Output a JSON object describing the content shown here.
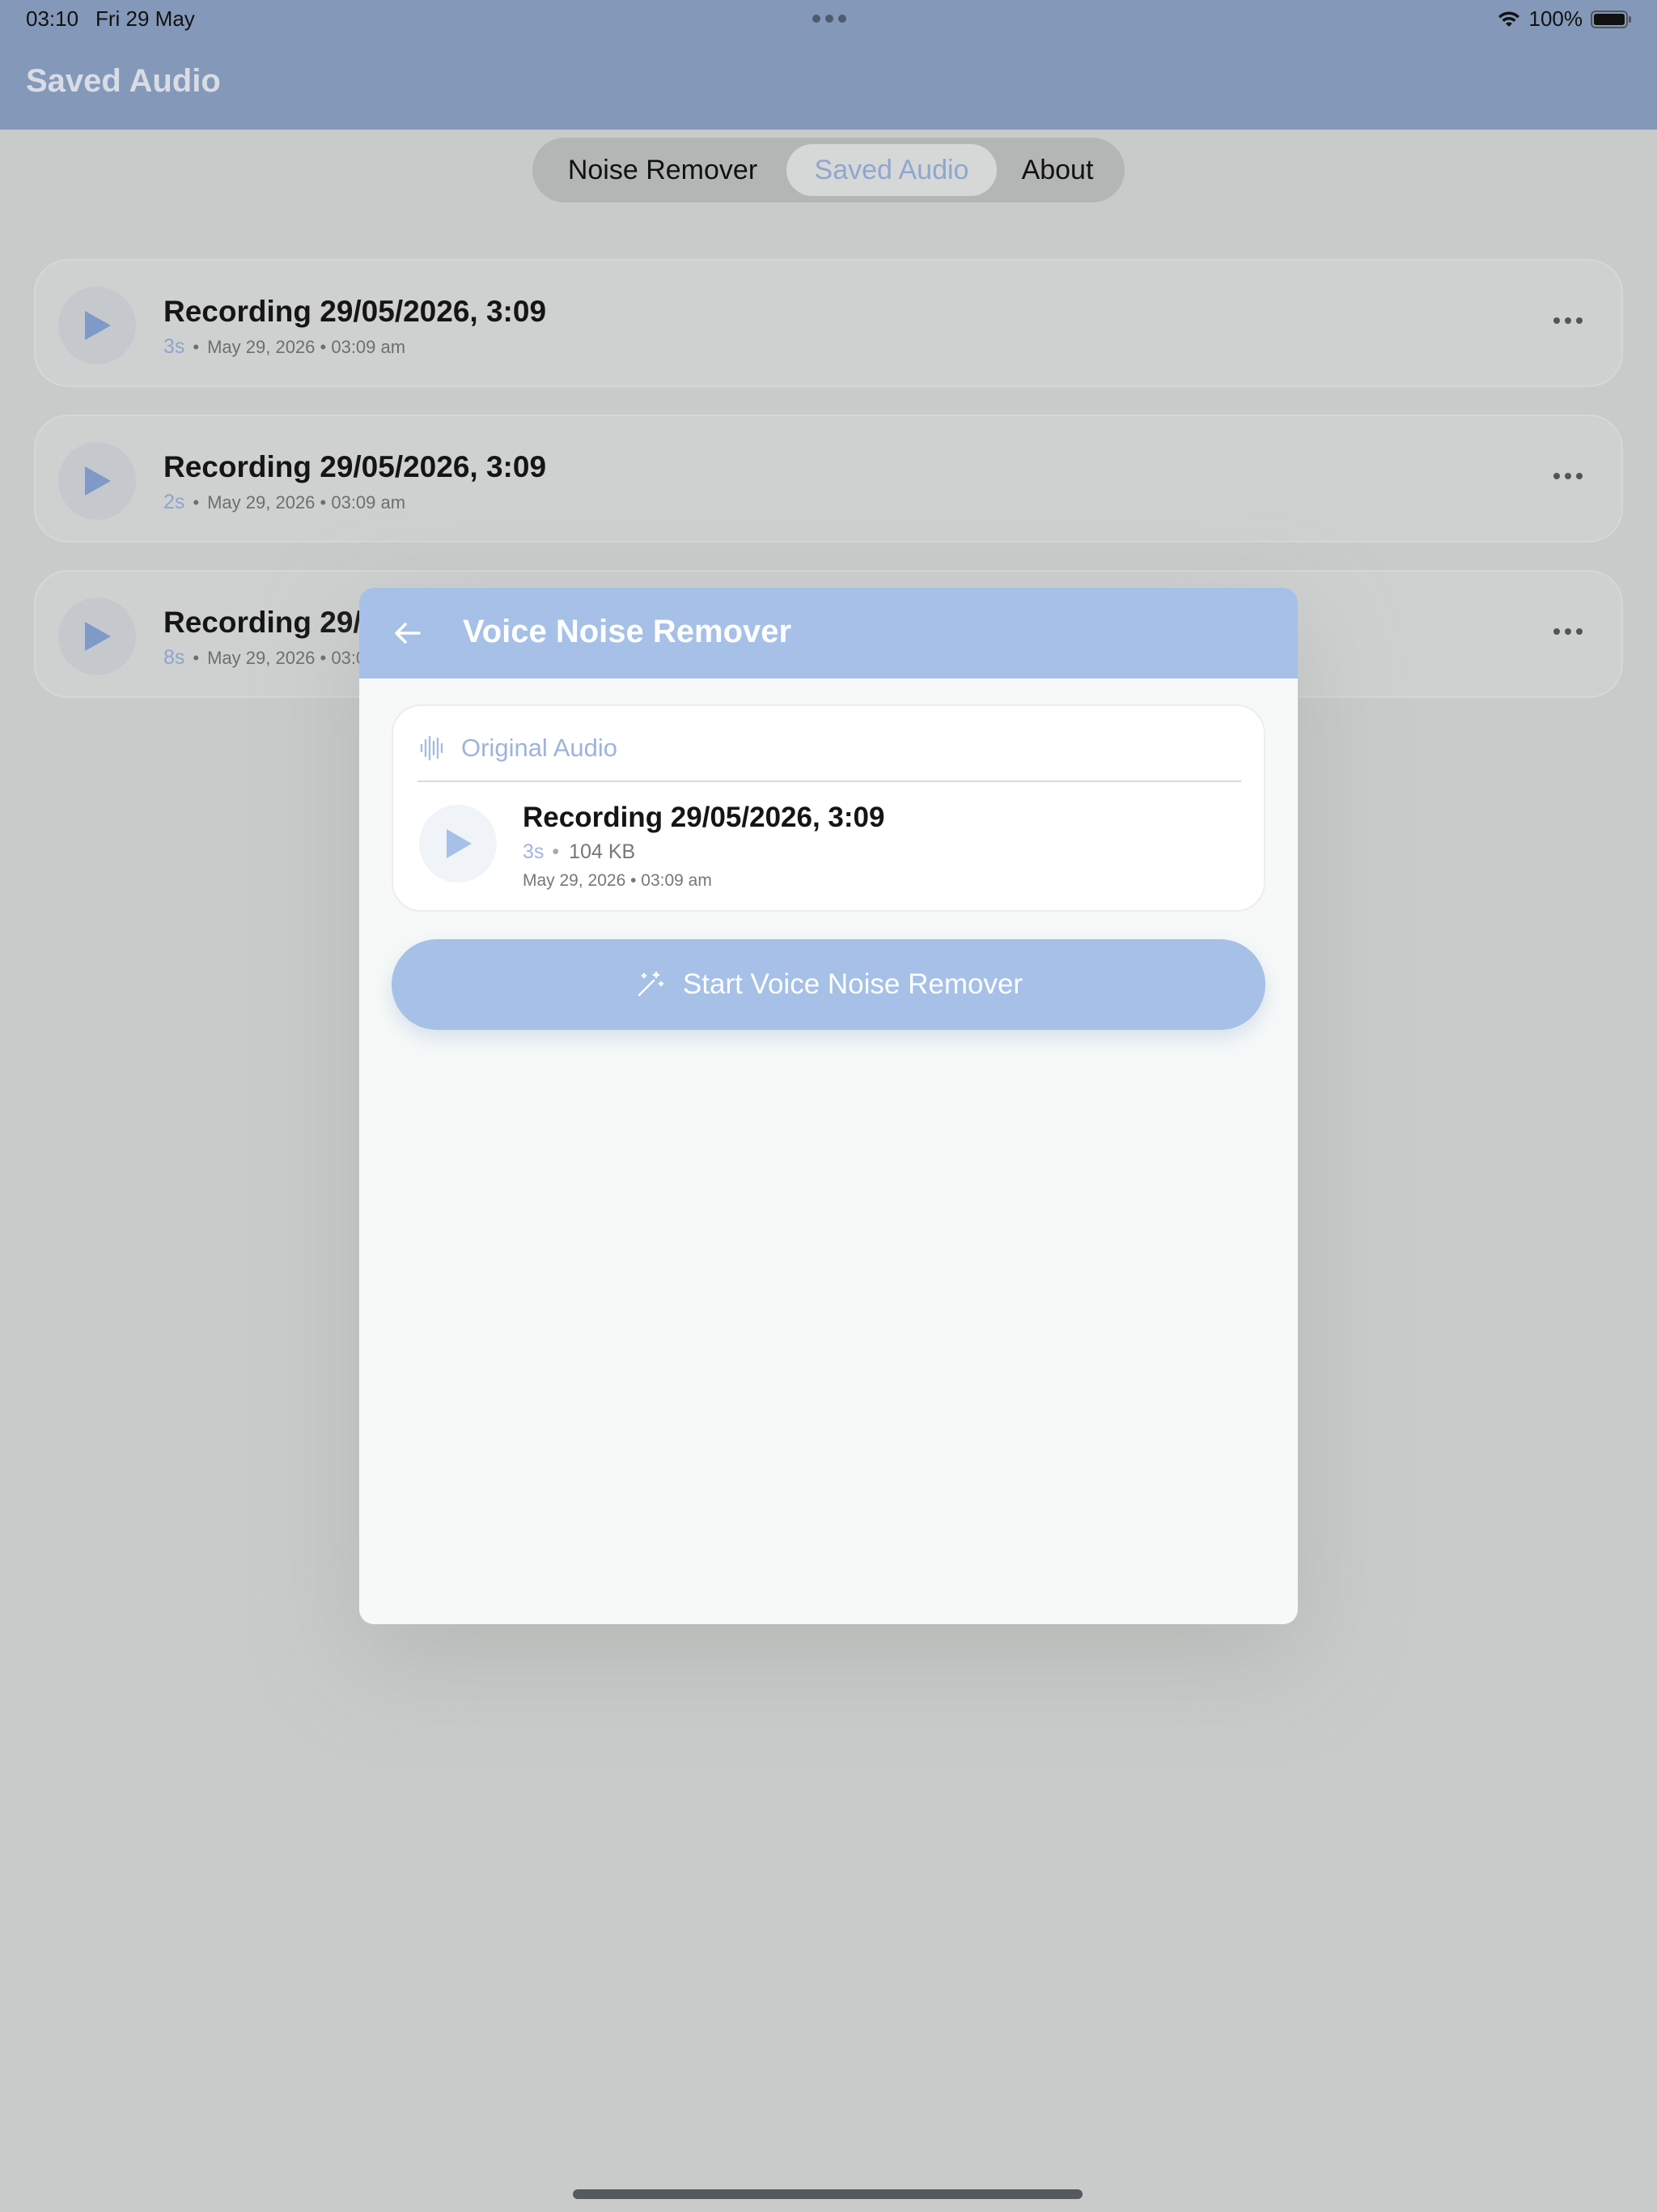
{
  "status_bar": {
    "time": "03:10",
    "date": "Fri 29 May",
    "battery": "100%",
    "icons": [
      "wifi-icon",
      "battery-icon"
    ]
  },
  "app": {
    "title": "Saved Audio"
  },
  "tabs": [
    {
      "label": "Noise Remover",
      "selected": false
    },
    {
      "label": "Saved Audio",
      "selected": true
    },
    {
      "label": "About",
      "selected": false
    }
  ],
  "recordings": [
    {
      "title": "Recording 29/05/2026, 3:09",
      "duration": "3s",
      "datetime": "May 29, 2026 • 03:09 am"
    },
    {
      "title": "Recording 29/05/2026, 3:09",
      "duration": "2s",
      "datetime": "May 29, 2026 • 03:09 am"
    },
    {
      "title": "Recording 29/05/2026, 3:09",
      "duration": "8s",
      "datetime": "May 29, 2026 • 03:09 am"
    }
  ],
  "modal": {
    "title": "Voice Noise Remover",
    "original_audio": {
      "label": "Original Audio",
      "title": "Recording 29/05/2026, 3:09",
      "duration": "3s",
      "size": "104 KB",
      "datetime": "May 29, 2026 • 03:09 am"
    },
    "start_button": "Start Voice Noise Remover"
  },
  "colors": {
    "app_bar": "#8498b9",
    "accent": "#a6c0e7",
    "accent_text": "#8fa6cf"
  }
}
